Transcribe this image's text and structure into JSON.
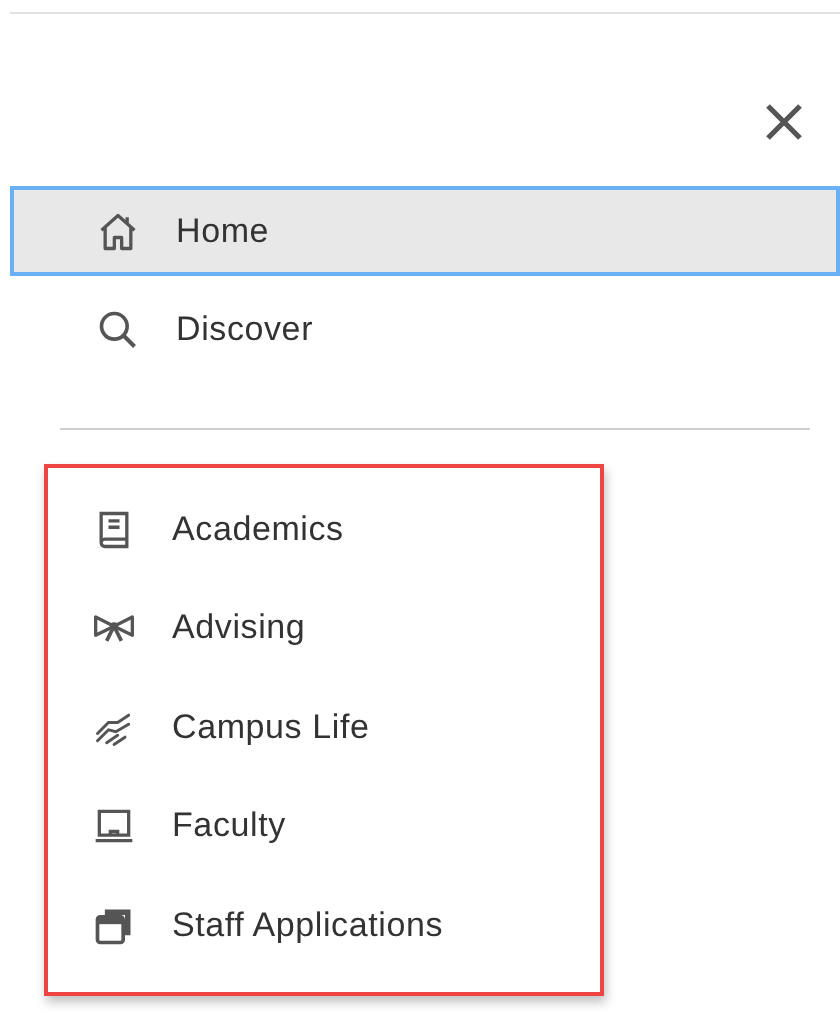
{
  "nav": {
    "primary": [
      {
        "label": "Home",
        "selected": true
      },
      {
        "label": "Discover",
        "selected": false
      }
    ],
    "secondary": [
      {
        "label": "Academics",
        "selected": false
      },
      {
        "label": "Advising",
        "selected": false
      },
      {
        "label": "Campus Life",
        "selected": false
      },
      {
        "label": "Faculty",
        "selected": false
      },
      {
        "label": "Staff Applications",
        "selected": false
      }
    ]
  }
}
